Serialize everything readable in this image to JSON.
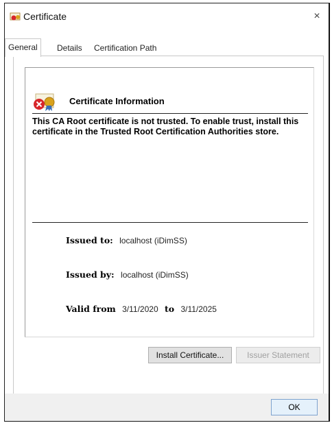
{
  "window": {
    "title": "Certificate",
    "close_glyph": "×"
  },
  "tabs": [
    {
      "label": "General"
    },
    {
      "label": "Details"
    },
    {
      "label": "Certification Path"
    }
  ],
  "info": {
    "heading": "Certificate Information",
    "message": "This CA Root certificate is not trusted. To enable trust, install this certificate in the Trusted Root Certification Authorities store.",
    "issued_to_label": "Issued to:",
    "issued_to_value": "localhost (iDimSS)",
    "issued_by_label": "Issued by:",
    "issued_by_value": "localhost (iDimSS)",
    "valid_from_label": "Valid from",
    "valid_from_value": "3/11/2020",
    "valid_to_label": "to",
    "valid_to_value": "3/11/2025"
  },
  "buttons": {
    "install": "Install Certificate...",
    "issuer_statement": "Issuer Statement",
    "ok": "OK"
  },
  "icons": {
    "title": "certificate-icon",
    "info": "certificate-error-icon"
  },
  "colors": {
    "error_red": "#d7262b",
    "ribbon_gold": "#d9a21b"
  }
}
